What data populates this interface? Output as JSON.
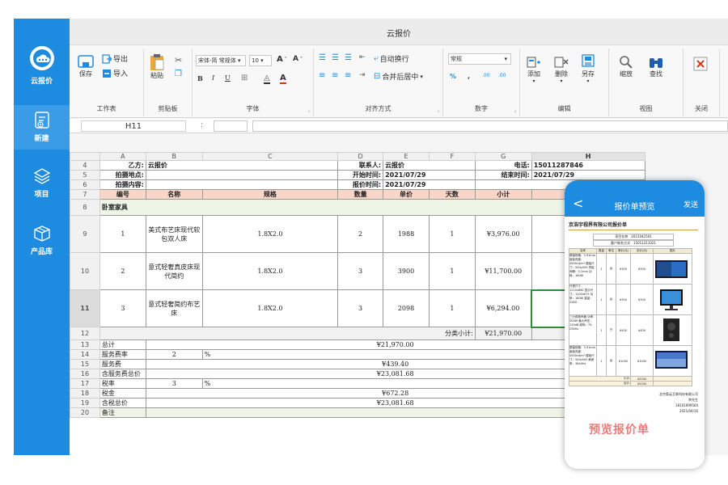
{
  "app": {
    "title": "云报价",
    "sidebar": [
      {
        "label": "云报价",
        "icon": "cloud-logo-icon"
      },
      {
        "label": "新建",
        "icon": "new-doc-icon"
      },
      {
        "label": "项目",
        "icon": "layers-icon"
      },
      {
        "label": "产品库",
        "icon": "box-icon"
      }
    ]
  },
  "ribbon": {
    "groups": {
      "worktable": "工作表",
      "clipboard": "剪贴板",
      "font": "字体",
      "align": "对齐方式",
      "number": "数字",
      "edit": "编辑",
      "view": "视图",
      "close": "关闭"
    },
    "save": "保存",
    "export": "导出",
    "import": "导入",
    "paste": "粘贴",
    "font_name": "宋体-简 常规体",
    "font_size": "10",
    "bold": "B",
    "italic": "I",
    "underline": "U",
    "grow": "A",
    "shrink": "A",
    "wrap": "自动换行",
    "merge": "合并后居中",
    "number_format": "常规",
    "percent": "%",
    "comma": ",",
    "dec_inc": ".00",
    "dec_dec": ".00",
    "add": "添加",
    "delete": "删除",
    "saveas": "另存",
    "zoom": "缩放",
    "find": "查找",
    "close_btn": "关闭"
  },
  "formula": {
    "cell_ref": "H11",
    "sep": ":"
  },
  "sheet": {
    "col_headers": [
      "A",
      "B",
      "C",
      "D",
      "E",
      "F",
      "G",
      "H"
    ],
    "r4": {
      "rn": "4",
      "a": "乙方:",
      "b": "云报价",
      "d": "联系人:",
      "e": "云报价",
      "g": "电话:",
      "h": "15011287846"
    },
    "r5": {
      "rn": "5",
      "a": "拍摄地点:",
      "d": "开始时间:",
      "e": "2021/07/29",
      "g": "结束时间:",
      "h": "2021/07/29"
    },
    "r6": {
      "rn": "6",
      "a": "拍摄内容:",
      "d": "报价时间:",
      "e": "2021/07/29"
    },
    "r7": {
      "rn": "7",
      "cols": [
        "编号",
        "名称",
        "规格",
        "数量",
        "单价",
        "天数",
        "小计"
      ]
    },
    "r8": {
      "rn": "8",
      "a": "卧室家具"
    },
    "items": [
      {
        "rn": "9",
        "no": "1",
        "name": "美式布艺床现代软包双人床",
        "spec": "1.8X2.0",
        "qty": "2",
        "price": "1988",
        "days": "1",
        "subtotal": "¥3,976.00"
      },
      {
        "rn": "10",
        "no": "2",
        "name": "意式轻奢真皮床现代简约",
        "spec": "1.8X2.0",
        "qty": "3",
        "price": "3900",
        "days": "1",
        "subtotal": "¥11,700.00"
      },
      {
        "rn": "11",
        "no": "3",
        "name": "意式轻奢简约布艺床",
        "spec": "1.8X2.0",
        "qty": "3",
        "price": "2098",
        "days": "1",
        "subtotal": "¥6,294.00"
      }
    ],
    "r12": {
      "rn": "12",
      "label": "分类小计:",
      "value": "¥21,970.00"
    },
    "totals": [
      {
        "rn": "13",
        "label": "总计",
        "value": "¥21,970.00"
      },
      {
        "rn": "14",
        "label": "服务费率",
        "value": "2",
        "unit": "%"
      },
      {
        "rn": "15",
        "label": "服务费",
        "value": "¥439.40"
      },
      {
        "rn": "16",
        "label": "含服务费总价",
        "value": "¥23,081.68"
      },
      {
        "rn": "17",
        "label": "税率",
        "value": "3",
        "unit": "%"
      },
      {
        "rn": "18",
        "label": "税金",
        "value": "¥672.28"
      },
      {
        "rn": "19",
        "label": "含税总价",
        "value": "¥23,081.68"
      },
      {
        "rn": "20",
        "label": "备注",
        "value": ""
      }
    ]
  },
  "phone": {
    "title": "报价单预览",
    "back": "<",
    "send": "发送",
    "doc_title": "京浩宇视界有限公司报价单",
    "meta1_label": "项目名称",
    "meta1_value": "2021042501",
    "meta2_label": "客户联系方式",
    "meta2_value": "15011211021",
    "doc_cols": [
      "名称",
      "数量",
      "单位",
      "单价(元)",
      "总价(元)",
      "图片"
    ],
    "doc_rows": [
      {
        "desc": "屏幕规格：3.91mm 面板亮度：4500cd/m² 模组尺寸：500x500 拼接间隙：0.1mm 功耗：160W",
        "qty": "1",
        "unit": "台",
        "price": "¥300",
        "total": "¥300"
      },
      {
        "desc": "外框尺寸：1210x680 显示尺寸：1200x675 功率：180W 重量：25KG",
        "qty": "1",
        "unit": "台",
        "price": "¥300",
        "total": "¥300"
      },
      {
        "desc": "三分频扬声器 功率：300W 最大声压：120dB 频响：70-20KHz",
        "qty": "1",
        "unit": "只",
        "price": "¥400",
        "total": "¥400"
      },
      {
        "desc": "屏幕规格：3.91mm 面板亮度：4500cd/m² 模组尺寸：500x500 刷新率：3840Hz",
        "qty": "1",
        "unit": "台",
        "price": "¥1000",
        "total": "¥1000"
      }
    ],
    "sum1_label": "小计:",
    "sum1_value": "¥2000",
    "sum2_label": "合计:",
    "sum2_value": "¥2000",
    "footer1": "北京奥云互联科技有限公司",
    "footer2": "李先生",
    "footer3": "18101099560",
    "footer4": "2021/04/16",
    "watermark": "预览报价单"
  },
  "colors": {
    "sidebar": "#1d8ce0",
    "header_row": "#f9d7c8",
    "section_row": "#eef5e6",
    "watermark": "#f07a7a",
    "accent_red": "#d9341c"
  }
}
